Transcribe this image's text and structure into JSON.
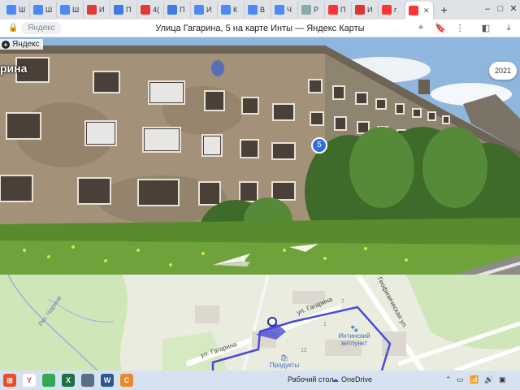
{
  "browser": {
    "tabs": [
      {
        "favicon": "yandex-doc-icon",
        "color": "#4c8bf5",
        "label": "Ш"
      },
      {
        "favicon": "yandex-doc-icon",
        "color": "#4c8bf5",
        "label": "Ш"
      },
      {
        "favicon": "yandex-doc-icon",
        "color": "#4c8bf5",
        "label": "Ш"
      },
      {
        "favicon": "pdf-icon",
        "color": "#e53935",
        "label": "И"
      },
      {
        "favicon": "mail-icon",
        "color": "#3f7be0",
        "label": "П"
      },
      {
        "favicon": "pdf-icon",
        "color": "#e53935",
        "label": "4("
      },
      {
        "favicon": "mail-icon",
        "color": "#3f7be0",
        "label": "П"
      },
      {
        "favicon": "yandex-doc-icon",
        "color": "#4c8bf5",
        "label": "И"
      },
      {
        "favicon": "yandex-doc-icon",
        "color": "#4c8bf5",
        "label": "К"
      },
      {
        "favicon": "yandex-doc-icon",
        "color": "#4c8bf5",
        "label": "В"
      },
      {
        "favicon": "yandex-doc-icon",
        "color": "#4c8bf5",
        "label": "Ч"
      },
      {
        "favicon": "globe-icon",
        "color": "#8aa",
        "label": "Р"
      },
      {
        "favicon": "yandex-icon",
        "color": "#f33",
        "label": "П"
      },
      {
        "favicon": "news-icon",
        "color": "#d33",
        "label": "И"
      },
      {
        "favicon": "yandex-icon",
        "color": "#f33",
        "label": "г"
      },
      {
        "favicon": "maps-pin-icon",
        "color": "#f33",
        "label": ""
      }
    ],
    "active_tab_index": 15,
    "site_name": "Яндекс",
    "page_title": "Улица Гагарина, 5 на карте Инты — Яндекс Карты"
  },
  "panorama": {
    "brand": "Яндекс",
    "street_label": "рина",
    "year": "2021",
    "house_number": "5"
  },
  "map": {
    "street_1": "ул. Гагарина",
    "street_2": "ул. Гагарина",
    "street_3": "Геофизическая ул.",
    "street_4": "Рег. Чарное",
    "poi_vet": "Интинский ветпункт",
    "poi_shop": "Продукты",
    "house_numbers": [
      "1",
      "12",
      "1",
      "2",
      "7"
    ]
  },
  "taskbar": {
    "desktop_label": "Рабочий стол",
    "onedrive_label": "OneDrive",
    "pinned_apps": [
      {
        "name": "yandex-browser-icon",
        "color": "#ffffff",
        "text": "Y"
      },
      {
        "name": "chrome-icon",
        "color": "#34a853",
        "text": ""
      },
      {
        "name": "excel-icon",
        "color": "#1d7044",
        "text": "X"
      },
      {
        "name": "calculator-icon",
        "color": "#5a6f86",
        "text": ""
      },
      {
        "name": "word-icon",
        "color": "#2b5797",
        "text": "W"
      },
      {
        "name": "presentation-icon",
        "color": "#e8892b",
        "text": "C"
      }
    ]
  }
}
